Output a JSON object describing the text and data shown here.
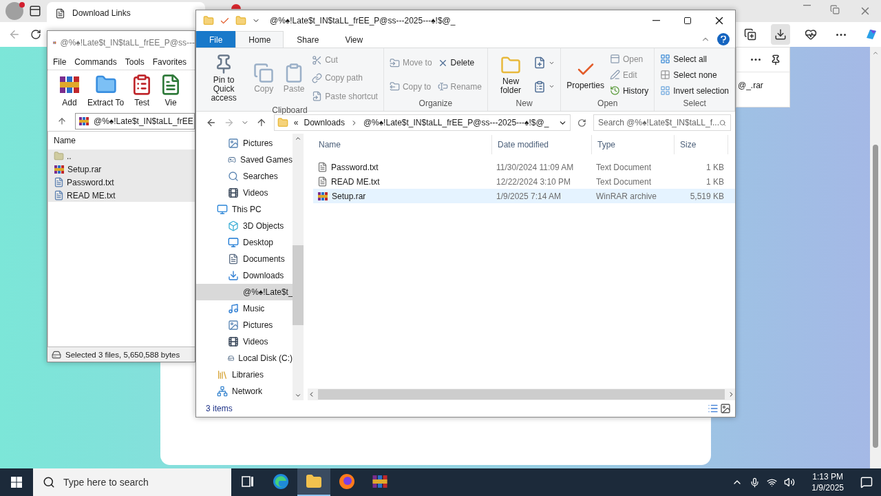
{
  "browser": {
    "tabs": [
      {
        "label": "Download Links",
        "selected": true
      }
    ],
    "downloads_panel": {
      "file": "@_.rar"
    }
  },
  "winrar": {
    "title": "@%♠!Late$t_IN$taLL_frEE_P@ss---",
    "menu": [
      "File",
      "Commands",
      "Tools",
      "Favorites"
    ],
    "toolbar": [
      {
        "label": "Add",
        "kind": "add"
      },
      {
        "label": "Extract To",
        "kind": "extract"
      },
      {
        "label": "Test",
        "kind": "test"
      },
      {
        "label": "Vie",
        "kind": "view"
      }
    ],
    "path": "@%♠!Late$t_IN$taLL_frEE",
    "column": "Name",
    "files": [
      {
        "name": "..",
        "kind": "up",
        "selected": true
      },
      {
        "name": "Setup.rar",
        "kind": "archive",
        "selected": true
      },
      {
        "name": "Password.txt",
        "kind": "text",
        "selected": true
      },
      {
        "name": "READ ME.txt",
        "kind": "text",
        "selected": true
      }
    ],
    "status": "Selected 3 files, 5,650,588 bytes"
  },
  "explorer": {
    "title": "@%♠!Late$t_IN$taLL_frEE_P@ss---2025---♠!$@_",
    "ribbon_tabs": [
      {
        "label": "File",
        "kind": "file",
        "selected": false
      },
      {
        "label": "Home",
        "kind": "tab",
        "selected": true
      },
      {
        "label": "Share",
        "kind": "tab",
        "selected": false
      },
      {
        "label": "View",
        "kind": "tab",
        "selected": false
      }
    ],
    "groups": [
      {
        "label": "Clipboard",
        "columns": [
          [
            {
              "label": "Pin to Quick access",
              "kind": "large",
              "disabled": false
            }
          ],
          [
            {
              "label": "Copy",
              "kind": "large",
              "disabled": true
            }
          ],
          [
            {
              "label": "Paste",
              "kind": "large",
              "disabled": true
            }
          ],
          [
            {
              "label": "Cut",
              "kind": "small",
              "disabled": true
            },
            {
              "label": "Copy path",
              "kind": "small",
              "disabled": true
            },
            {
              "label": "Paste shortcut",
              "kind": "small",
              "disabled": true
            }
          ]
        ]
      },
      {
        "label": "Organize",
        "columns": [
          [
            {
              "label": "Move to",
              "kind": "small",
              "disabled": true
            },
            {
              "label": "Copy to",
              "kind": "small",
              "disabled": true
            }
          ],
          [
            {
              "label": "Delete",
              "kind": "small",
              "disabled": false
            },
            {
              "label": "Rename",
              "kind": "small",
              "disabled": true
            }
          ]
        ]
      },
      {
        "label": "New",
        "columns": [
          [
            {
              "label": "New folder",
              "kind": "large",
              "disabled": false
            }
          ],
          [
            {
              "kind": "icon",
              "disabled": false
            },
            {
              "kind": "icon",
              "disabled": false
            }
          ]
        ]
      },
      {
        "label": "Open",
        "columns": [
          [
            {
              "label": "Properties",
              "kind": "large",
              "disabled": false
            }
          ],
          [
            {
              "label": "Open",
              "kind": "small",
              "disabled": true
            },
            {
              "label": "Edit",
              "kind": "small",
              "disabled": true
            },
            {
              "label": "History",
              "kind": "small",
              "disabled": false
            }
          ]
        ]
      },
      {
        "label": "Select",
        "columns": [
          [
            {
              "label": "Select all",
              "kind": "small",
              "disabled": false
            },
            {
              "label": "Select none",
              "kind": "small",
              "disabled": false
            },
            {
              "label": "Invert selection",
              "kind": "small",
              "disabled": false
            }
          ]
        ]
      }
    ],
    "breadcrumb_overflow": "«",
    "breadcrumb": [
      "Downloads",
      "@%♠!Late$t_IN$taLL_frEE_P@ss---2025---♠!$@_"
    ],
    "search": {
      "placeholder": "Search @%♠!Late$t_IN$taLL_f..."
    },
    "nav": [
      {
        "children": [
          {
            "label": "Pictures",
            "kind": "pictures",
            "selected": false
          },
          {
            "label": "Saved Games",
            "kind": "games",
            "selected": false
          },
          {
            "label": "Searches",
            "kind": "search",
            "selected": false
          },
          {
            "label": "Videos",
            "kind": "videos",
            "selected": false
          }
        ]
      },
      {
        "label": "This PC",
        "kind": "pc",
        "selected": false,
        "children": [
          {
            "label": "3D Objects",
            "kind": "objects",
            "selected": false
          },
          {
            "label": "Desktop",
            "kind": "desktop",
            "selected": false
          },
          {
            "label": "Documents",
            "kind": "documents",
            "selected": false
          },
          {
            "label": "Downloads",
            "kind": "downloads",
            "selected": false,
            "children": [
              {
                "label": "@%♠!Late$t_",
                "kind": "folder",
                "selected": true
              }
            ]
          },
          {
            "label": "Music",
            "kind": "music",
            "selected": false
          },
          {
            "label": "Pictures",
            "kind": "pictures",
            "selected": false
          },
          {
            "label": "Videos",
            "kind": "videos",
            "selected": false
          },
          {
            "label": "Local Disk (C:)",
            "kind": "disk",
            "selected": false
          }
        ]
      },
      {
        "label": "Libraries",
        "kind": "libraries",
        "selected": false
      },
      {
        "label": "Network",
        "kind": "network",
        "selected": false
      }
    ],
    "columns": [
      "Name",
      "Date modified",
      "Type",
      "Size"
    ],
    "rows": [
      {
        "name": "Password.txt",
        "kind": "text",
        "date": "11/30/2024 11:09 AM",
        "type": "Text Document",
        "size": "1 KB",
        "selected": false
      },
      {
        "name": "READ ME.txt",
        "kind": "text",
        "date": "12/22/2024 3:10 PM",
        "type": "Text Document",
        "size": "1 KB",
        "selected": false
      },
      {
        "name": "Setup.rar",
        "kind": "archive",
        "date": "1/9/2025 7:14 AM",
        "type": "WinRAR archive",
        "size": "5,519 KB",
        "selected": true
      }
    ],
    "status": "3 items"
  },
  "taskbar": {
    "search": {
      "placeholder": "Type here to search"
    },
    "apps": [
      {
        "kind": "taskview",
        "selected": false
      },
      {
        "kind": "edge",
        "selected": false
      },
      {
        "kind": "explorer",
        "selected": true
      },
      {
        "kind": "firefox",
        "selected": false
      },
      {
        "kind": "winrar",
        "selected": false
      }
    ],
    "time": "1:13 PM",
    "date": "1/9/2025"
  }
}
